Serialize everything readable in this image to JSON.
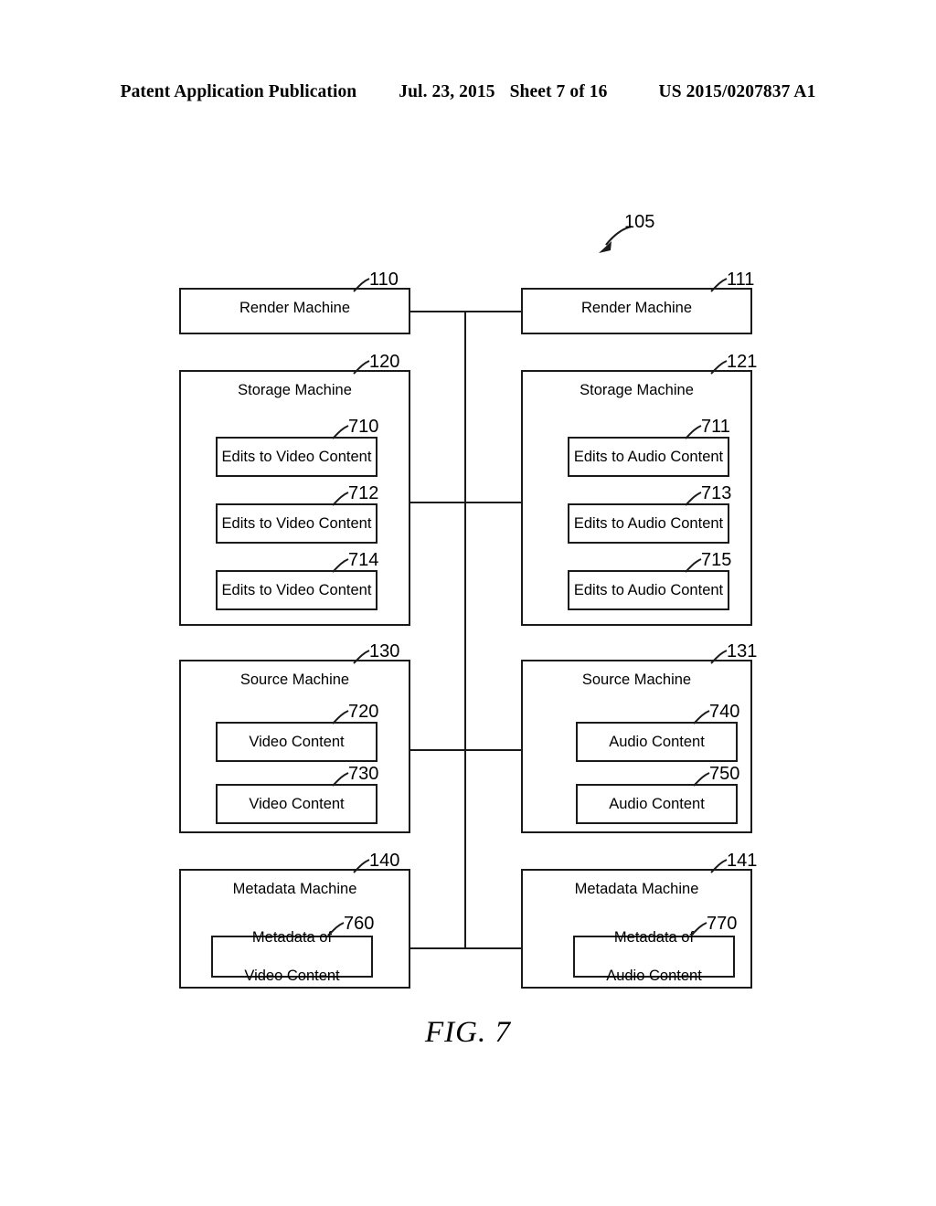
{
  "header": {
    "publication": "Patent Application Publication",
    "date": "Jul. 23, 2015",
    "sheet": "Sheet 7 of 16",
    "patent_number": "US 2015/0207837 A1"
  },
  "figure": {
    "caption": "FIG. 7",
    "system_ref": "105",
    "rows": [
      {
        "id": "render",
        "left": {
          "ref": "110",
          "title": "Render Machine",
          "items": []
        },
        "right": {
          "ref": "111",
          "title": "Render Machine",
          "items": []
        }
      },
      {
        "id": "storage",
        "left": {
          "ref": "120",
          "title": "Storage Machine",
          "items": [
            {
              "ref": "710",
              "label": "Edits to Video Content"
            },
            {
              "ref": "712",
              "label": "Edits to Video Content"
            },
            {
              "ref": "714",
              "label": "Edits to Video Content"
            }
          ]
        },
        "right": {
          "ref": "121",
          "title": "Storage Machine",
          "items": [
            {
              "ref": "711",
              "label": "Edits to Audio Content"
            },
            {
              "ref": "713",
              "label": "Edits to Audio Content"
            },
            {
              "ref": "715",
              "label": "Edits to Audio Content"
            }
          ]
        }
      },
      {
        "id": "source",
        "left": {
          "ref": "130",
          "title": "Source Machine",
          "items": [
            {
              "ref": "720",
              "label": "Video Content"
            },
            {
              "ref": "730",
              "label": "Video Content"
            }
          ]
        },
        "right": {
          "ref": "131",
          "title": "Source Machine",
          "items": [
            {
              "ref": "740",
              "label": "Audio Content"
            },
            {
              "ref": "750",
              "label": "Audio Content"
            }
          ]
        }
      },
      {
        "id": "metadata",
        "left": {
          "ref": "140",
          "title": "Metadata Machine",
          "items": [
            {
              "ref": "760",
              "label_line1": "Metadata of",
              "label_line2": "Video Content"
            }
          ]
        },
        "right": {
          "ref": "141",
          "title": "Metadata Machine",
          "items": [
            {
              "ref": "770",
              "label_line1": "Metadata of",
              "label_line2": "Audio Content"
            }
          ]
        }
      }
    ]
  },
  "colors": {
    "line": "#1a1a1a",
    "background": "#ffffff"
  }
}
